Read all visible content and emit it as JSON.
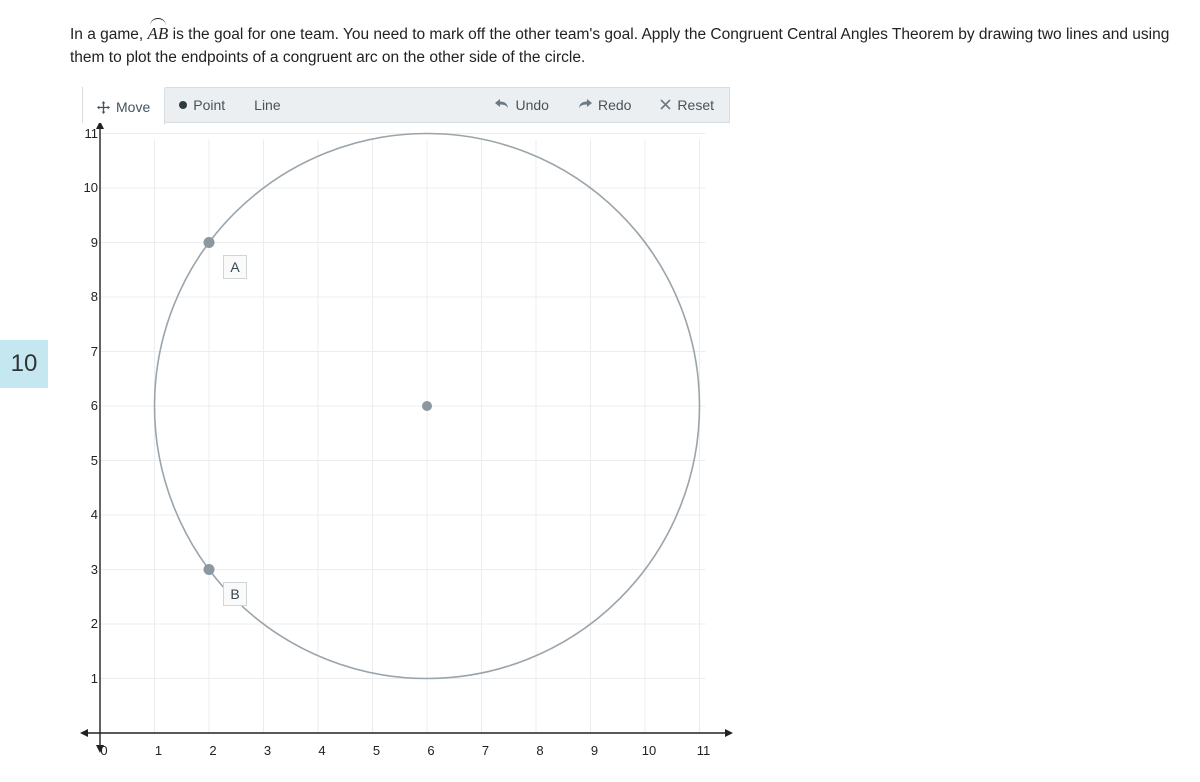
{
  "question_number": "10",
  "instructions_prefix": "In a game, ",
  "instructions_arc": "AB",
  "instructions_suffix": " is the goal for one team. You need to mark off the other team's goal. Apply the Congruent Central Angles Theorem by drawing two lines and using them to plot the endpoints of a congruent arc on the other side of the circle.",
  "toolbar": {
    "move": "Move",
    "point": "Point",
    "line": "Line",
    "undo": "Undo",
    "redo": "Redo",
    "reset": "Reset"
  },
  "graph": {
    "x_ticks": [
      "0",
      "1",
      "2",
      "3",
      "4",
      "5",
      "6",
      "7",
      "8",
      "9",
      "10",
      "11"
    ],
    "y_ticks": [
      "0",
      "1",
      "2",
      "3",
      "4",
      "5",
      "6",
      "7",
      "8",
      "9",
      "10",
      "11"
    ],
    "circle": {
      "cx": 6,
      "cy": 6,
      "r": 5
    },
    "points": {
      "center": {
        "x": 6,
        "y": 6
      },
      "A": {
        "x": 2,
        "y": 9,
        "label": "A"
      },
      "B": {
        "x": 2,
        "y": 3,
        "label": "B"
      }
    }
  }
}
